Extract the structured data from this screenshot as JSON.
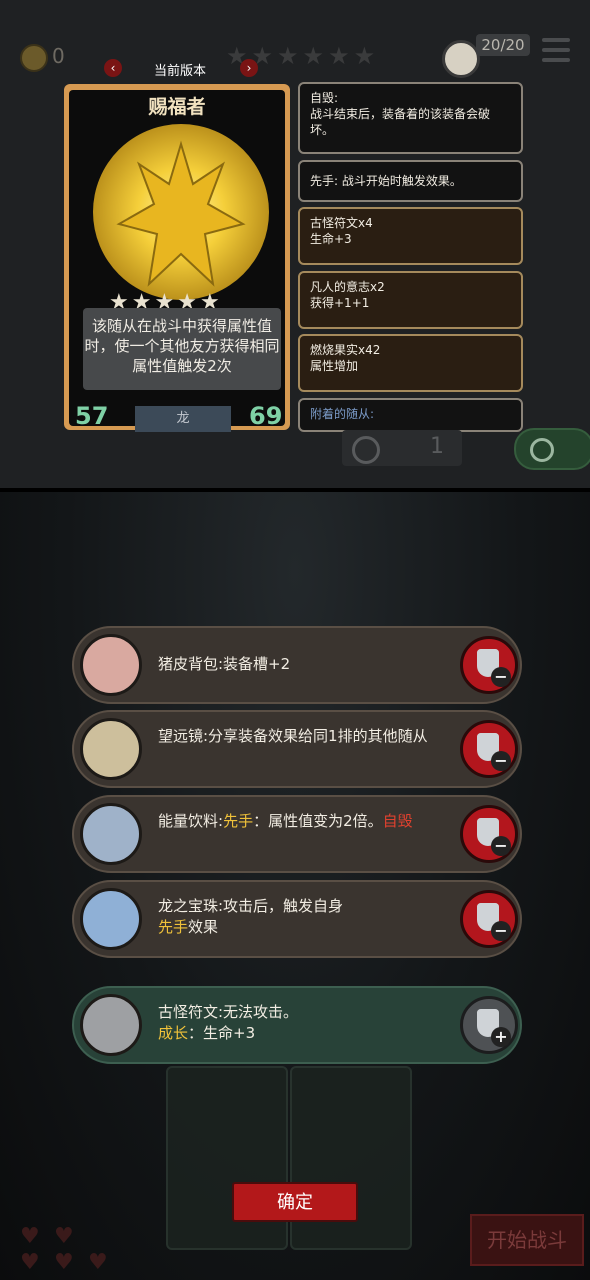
{
  "header": {
    "coin_count": "0",
    "card_count": "20/20",
    "version_label": "当前版本"
  },
  "card": {
    "name": "赐福者",
    "description": "该随从在战斗中获得属性值时，使一个其他友方获得相同属性值触发2次",
    "attack": "57",
    "health": "69",
    "tribe": "龙",
    "stars": 5
  },
  "effects": [
    {
      "title": "自毁:",
      "body": "战斗结束后，装备着的该装备会破坏。"
    },
    {
      "title": "先手: 战斗开始时触发效果。",
      "body": ""
    },
    {
      "title": "古怪符文x4",
      "body": "生命+3"
    },
    {
      "title": "凡人的意志x2",
      "body": "获得+1+1"
    },
    {
      "title": "燃烧果实x42",
      "body": "属性增加"
    },
    {
      "title": "附着的随从:",
      "body": ""
    }
  ],
  "recycle_count": "1",
  "items": [
    {
      "text": "猪皮背包:装备槽+2"
    },
    {
      "text": "望远镜:分享装备效果给同1排的其他随从"
    },
    {
      "prefix": "能量饮料:",
      "hl1": "先手",
      "mid": "：属性值变为2倍。",
      "hl2": "自毁"
    },
    {
      "prefix": "龙之宝珠:攻击后，触发自身",
      "hl1": "先手",
      "mid": "效果"
    },
    {
      "prefix": "古怪符文:无法攻击。",
      "hl1": "成长",
      "mid": "：生命+3"
    }
  ],
  "buttons": {
    "remove": "−",
    "add": "+",
    "confirm": "确定",
    "start_battle": "开始战斗"
  }
}
